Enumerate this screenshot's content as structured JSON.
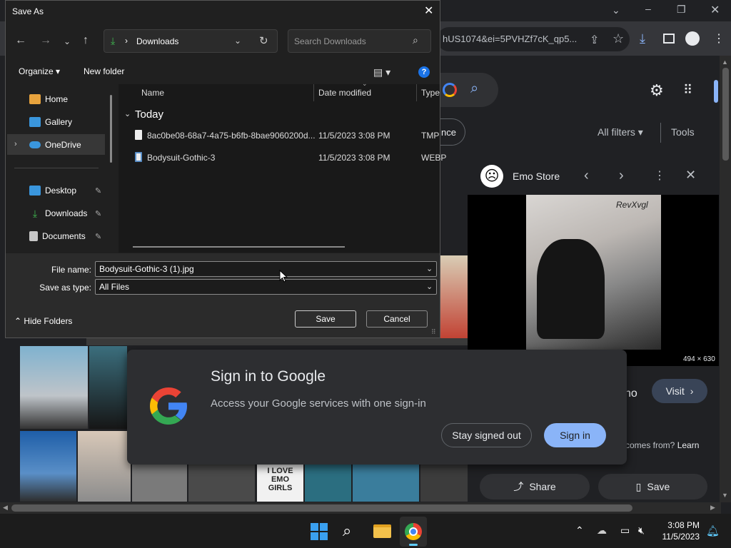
{
  "browser": {
    "omnibox_url": "hUS1074&ei=5PVHZf7cK_qp5...",
    "top_bar": {
      "settings": "settings",
      "apps": "apps"
    },
    "search_suffix": "nce",
    "filters": {
      "all_filters": "All filters",
      "tools": "Tools"
    }
  },
  "panel": {
    "title": "Emo Store",
    "image_caption": "494 × 630",
    "result_text": "no",
    "visit_label": "Visit",
    "comes_from": "comes from?",
    "learn": "Learn",
    "share_label": "Share",
    "save_label": "Save",
    "watermark": "RevXvgl"
  },
  "thumbs": {
    "emo_text": "EMO\nGIRLS",
    "emo_line1": "I LOVE",
    "emo_line2": "EMO",
    "emo_line3": "GIRLS"
  },
  "dialog": {
    "title": "Save As",
    "address_folder": "Downloads",
    "search_placeholder": "Search Downloads",
    "organize": "Organize",
    "new_folder": "New folder",
    "nav": {
      "home": "Home",
      "gallery": "Gallery",
      "onedrive": "OneDrive",
      "desktop": "Desktop",
      "downloads": "Downloads",
      "documents": "Documents"
    },
    "columns": {
      "name": "Name",
      "date": "Date modified",
      "type": "Type"
    },
    "group": "Today",
    "files": [
      {
        "name": "8ac0be08-68a7-4a75-b6fb-8bae9060200d...",
        "date": "11/5/2023 3:08 PM",
        "type": "TMP"
      },
      {
        "name": "Bodysuit-Gothic-3",
        "date": "11/5/2023 3:08 PM",
        "type": "WEBP"
      }
    ],
    "file_name_label": "File name:",
    "file_name_value": "Bodysuit-Gothic-3 (1).jpg",
    "save_type_label": "Save as type:",
    "save_type_value": "All Files",
    "hide_folders": "Hide Folders",
    "save": "Save",
    "cancel": "Cancel"
  },
  "signin": {
    "title": "Sign in to Google",
    "subtitle": "Access your Google services with one sign-in",
    "stay_signed_out": "Stay signed out",
    "sign_in": "Sign in"
  },
  "taskbar": {
    "time": "3:08 PM",
    "date": "11/5/2023"
  },
  "colors": {
    "google_blue": "#4285f4",
    "google_red": "#ea4335",
    "google_yellow": "#fbbc05",
    "google_green": "#34a853",
    "signin_button": "#8ab4f8",
    "download_green": "#3fb950"
  }
}
